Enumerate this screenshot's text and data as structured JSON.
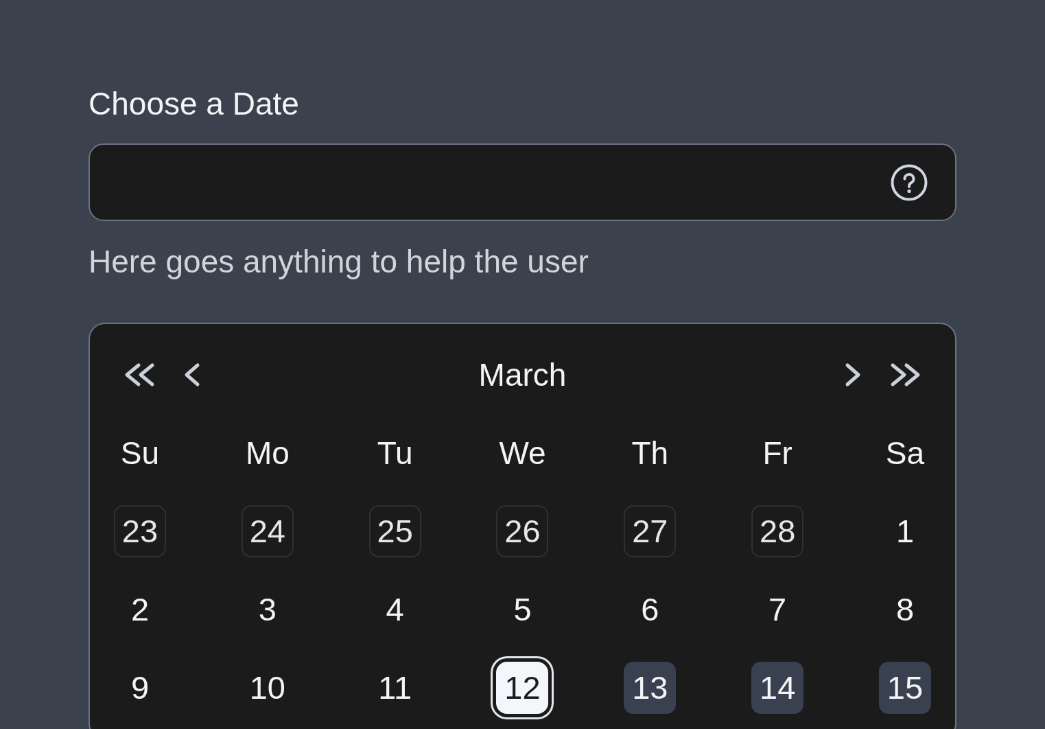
{
  "field": {
    "label": "Choose a Date",
    "helper": "Here goes anything to help the user"
  },
  "calendar": {
    "month": "March",
    "weekdays": [
      "Su",
      "Mo",
      "Tu",
      "We",
      "Th",
      "Fr",
      "Sa"
    ],
    "weeks": [
      [
        {
          "day": "23",
          "outside": true,
          "selected": false,
          "in_range": false
        },
        {
          "day": "24",
          "outside": true,
          "selected": false,
          "in_range": false
        },
        {
          "day": "25",
          "outside": true,
          "selected": false,
          "in_range": false
        },
        {
          "day": "26",
          "outside": true,
          "selected": false,
          "in_range": false
        },
        {
          "day": "27",
          "outside": true,
          "selected": false,
          "in_range": false
        },
        {
          "day": "28",
          "outside": true,
          "selected": false,
          "in_range": false
        },
        {
          "day": "1",
          "outside": false,
          "selected": false,
          "in_range": false
        }
      ],
      [
        {
          "day": "2",
          "outside": false,
          "selected": false,
          "in_range": false
        },
        {
          "day": "3",
          "outside": false,
          "selected": false,
          "in_range": false
        },
        {
          "day": "4",
          "outside": false,
          "selected": false,
          "in_range": false
        },
        {
          "day": "5",
          "outside": false,
          "selected": false,
          "in_range": false
        },
        {
          "day": "6",
          "outside": false,
          "selected": false,
          "in_range": false
        },
        {
          "day": "7",
          "outside": false,
          "selected": false,
          "in_range": false
        },
        {
          "day": "8",
          "outside": false,
          "selected": false,
          "in_range": false
        }
      ],
      [
        {
          "day": "9",
          "outside": false,
          "selected": false,
          "in_range": false
        },
        {
          "day": "10",
          "outside": false,
          "selected": false,
          "in_range": false
        },
        {
          "day": "11",
          "outside": false,
          "selected": false,
          "in_range": false
        },
        {
          "day": "12",
          "outside": false,
          "selected": true,
          "in_range": false
        },
        {
          "day": "13",
          "outside": false,
          "selected": false,
          "in_range": true
        },
        {
          "day": "14",
          "outside": false,
          "selected": false,
          "in_range": true
        },
        {
          "day": "15",
          "outside": false,
          "selected": false,
          "in_range": true
        }
      ]
    ]
  }
}
